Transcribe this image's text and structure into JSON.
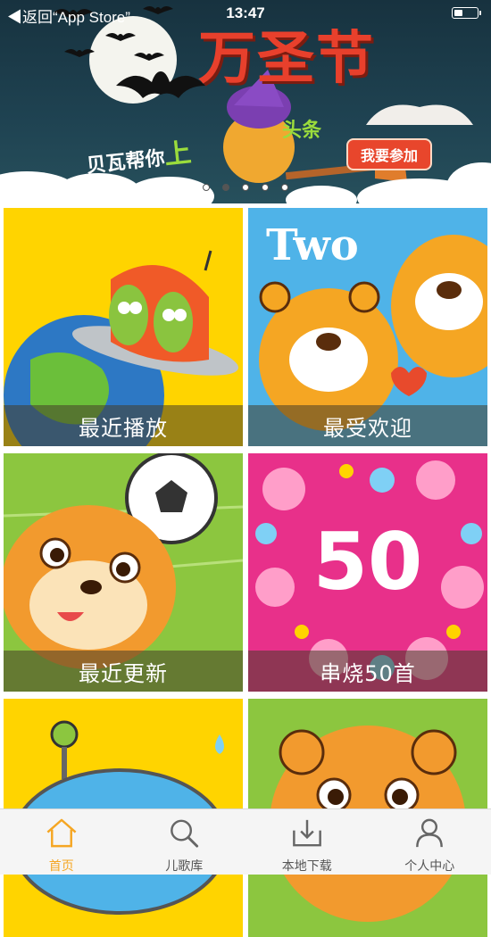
{
  "status_bar": {
    "back_label": "◀返回“App Store”",
    "time": "13:47"
  },
  "banner": {
    "title": "万圣节",
    "slogan_prefix": "贝瓦帮你",
    "slogan_big": "上",
    "slogan_suffix": "头条",
    "join_button": "我要参加",
    "page_dots_total": 5,
    "page_dots_active": 1
  },
  "tiles": [
    {
      "label": "最近播放"
    },
    {
      "label": "最受欢迎"
    },
    {
      "label": "最近更新"
    },
    {
      "label": "串烧50首"
    },
    {
      "label": ""
    },
    {
      "label": ""
    }
  ],
  "tile_art_text": {
    "two": "Two",
    "fifty": "50"
  },
  "tabbar": [
    {
      "label": "首页",
      "icon": "home-icon",
      "active": true
    },
    {
      "label": "儿歌库",
      "icon": "search-icon",
      "active": false
    },
    {
      "label": "本地下载",
      "icon": "download-icon",
      "active": false
    },
    {
      "label": "个人中心",
      "icon": "person-icon",
      "active": false
    }
  ],
  "colors": {
    "accent": "#f5a623",
    "banner_red": "#e8402c",
    "tile_yellow": "#ffd400",
    "tile_blue": "#4fb3e8",
    "tile_green": "#8cc63f",
    "tile_pink": "#e8308a"
  }
}
